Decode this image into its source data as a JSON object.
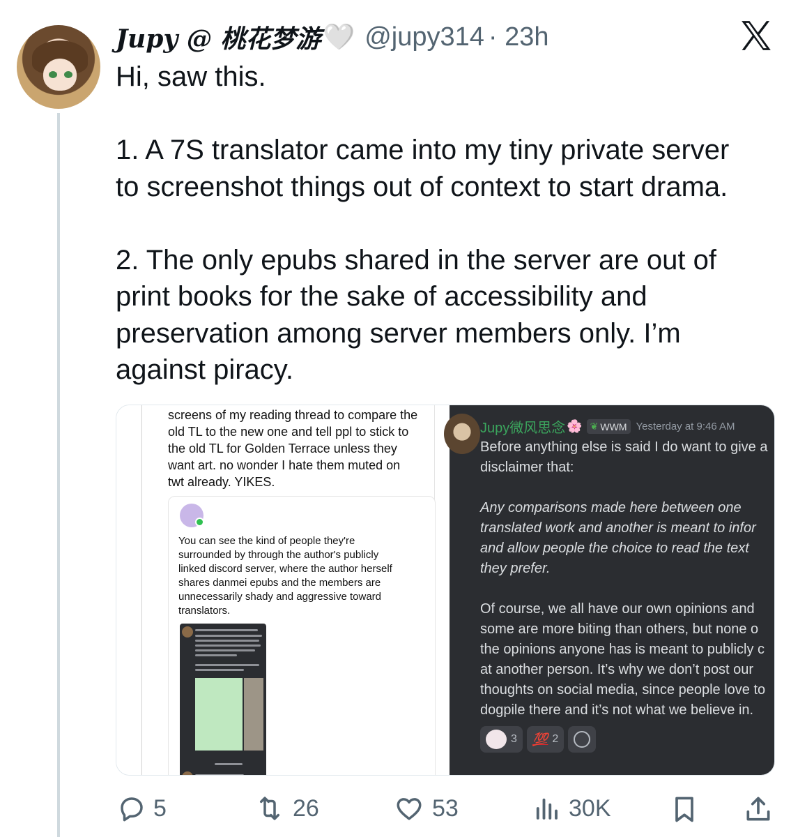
{
  "tweet": {
    "display_name": "Jupy @ 桃花梦游",
    "heart": "🤍",
    "handle": "@jupy314",
    "time": "· 23h",
    "lines_p1": [
      "Hi, saw this."
    ],
    "lines_p2": [
      "1. A 7S translator came into my tiny private server",
      "to screenshot things out of context to start drama."
    ],
    "lines_p3": [
      "2. The only epubs shared in the server are out of",
      "print books for the sake of accessibility and",
      "preservation among server members only. I’m",
      "against piracy."
    ]
  },
  "media": {
    "left": {
      "post_lines": [
        "screens of my reading thread to compare the",
        "old TL to the new one and tell ppl to stick to",
        "the old TL for Golden Terrace unless they",
        "want art. no wonder I hate them muted on",
        "twt already. YIKES."
      ],
      "reply_lines": [
        "You can see the kind of people they're",
        "surrounded by through the author's publicly",
        "linked discord server, where the author herself",
        "shares danmei epubs and the members are",
        "unnecessarily shady and aggressive toward",
        "translators."
      ]
    },
    "right": {
      "name": "Jupy微风思念",
      "flower": "🌸",
      "role_tag": "WWM",
      "timestamp": "Yesterday at 9:46 AM",
      "para1": [
        "Before anything else is said I do want to give a",
        "disclaimer that:"
      ],
      "para2_italic": [
        "Any comparisons made here between one",
        "translated work and another is meant to infor",
        "and allow people the choice to read the text",
        "they prefer."
      ],
      "para3": [
        "Of course, we all have our own opinions and",
        "some are more biting than others, but none o",
        "the opinions anyone has is meant to publicly c",
        "at another person. It’s why we don’t post our",
        "thoughts on social media, since people love to",
        "dogpile there and it’s not what we believe in."
      ],
      "reactions": [
        {
          "emoji": "sticker-face",
          "count": "3"
        },
        {
          "emoji": "💯",
          "count": "2"
        }
      ]
    }
  },
  "actions": {
    "replies": "5",
    "retweets": "26",
    "likes": "53",
    "views": "30K"
  }
}
